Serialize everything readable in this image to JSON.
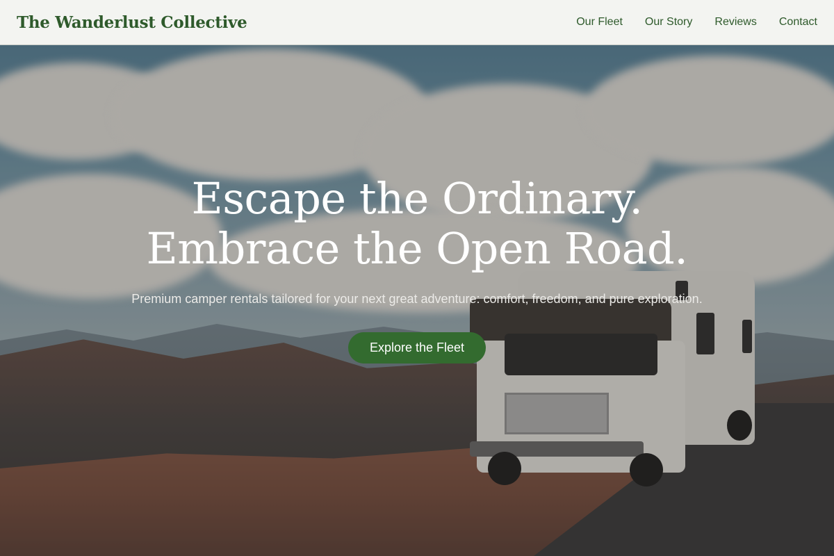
{
  "brand": {
    "name": "The Wanderlust Collective"
  },
  "nav": {
    "items": [
      "Our Fleet",
      "Our Story",
      "Reviews",
      "Contact"
    ]
  },
  "hero": {
    "headline_line1": "Escape the Ordinary.",
    "headline_line2": "Embrace the Open Road.",
    "subtitle": "Premium camper rentals tailored for your next great adventure: comfort, freedom, and pure exploration.",
    "cta_label": "Explore the Fleet",
    "background_image": "camper-on-mountain-road"
  },
  "colors": {
    "accent": "#336b2f",
    "brand_text": "#2e5a2b",
    "navbar_bg": "#f3f4f1"
  }
}
